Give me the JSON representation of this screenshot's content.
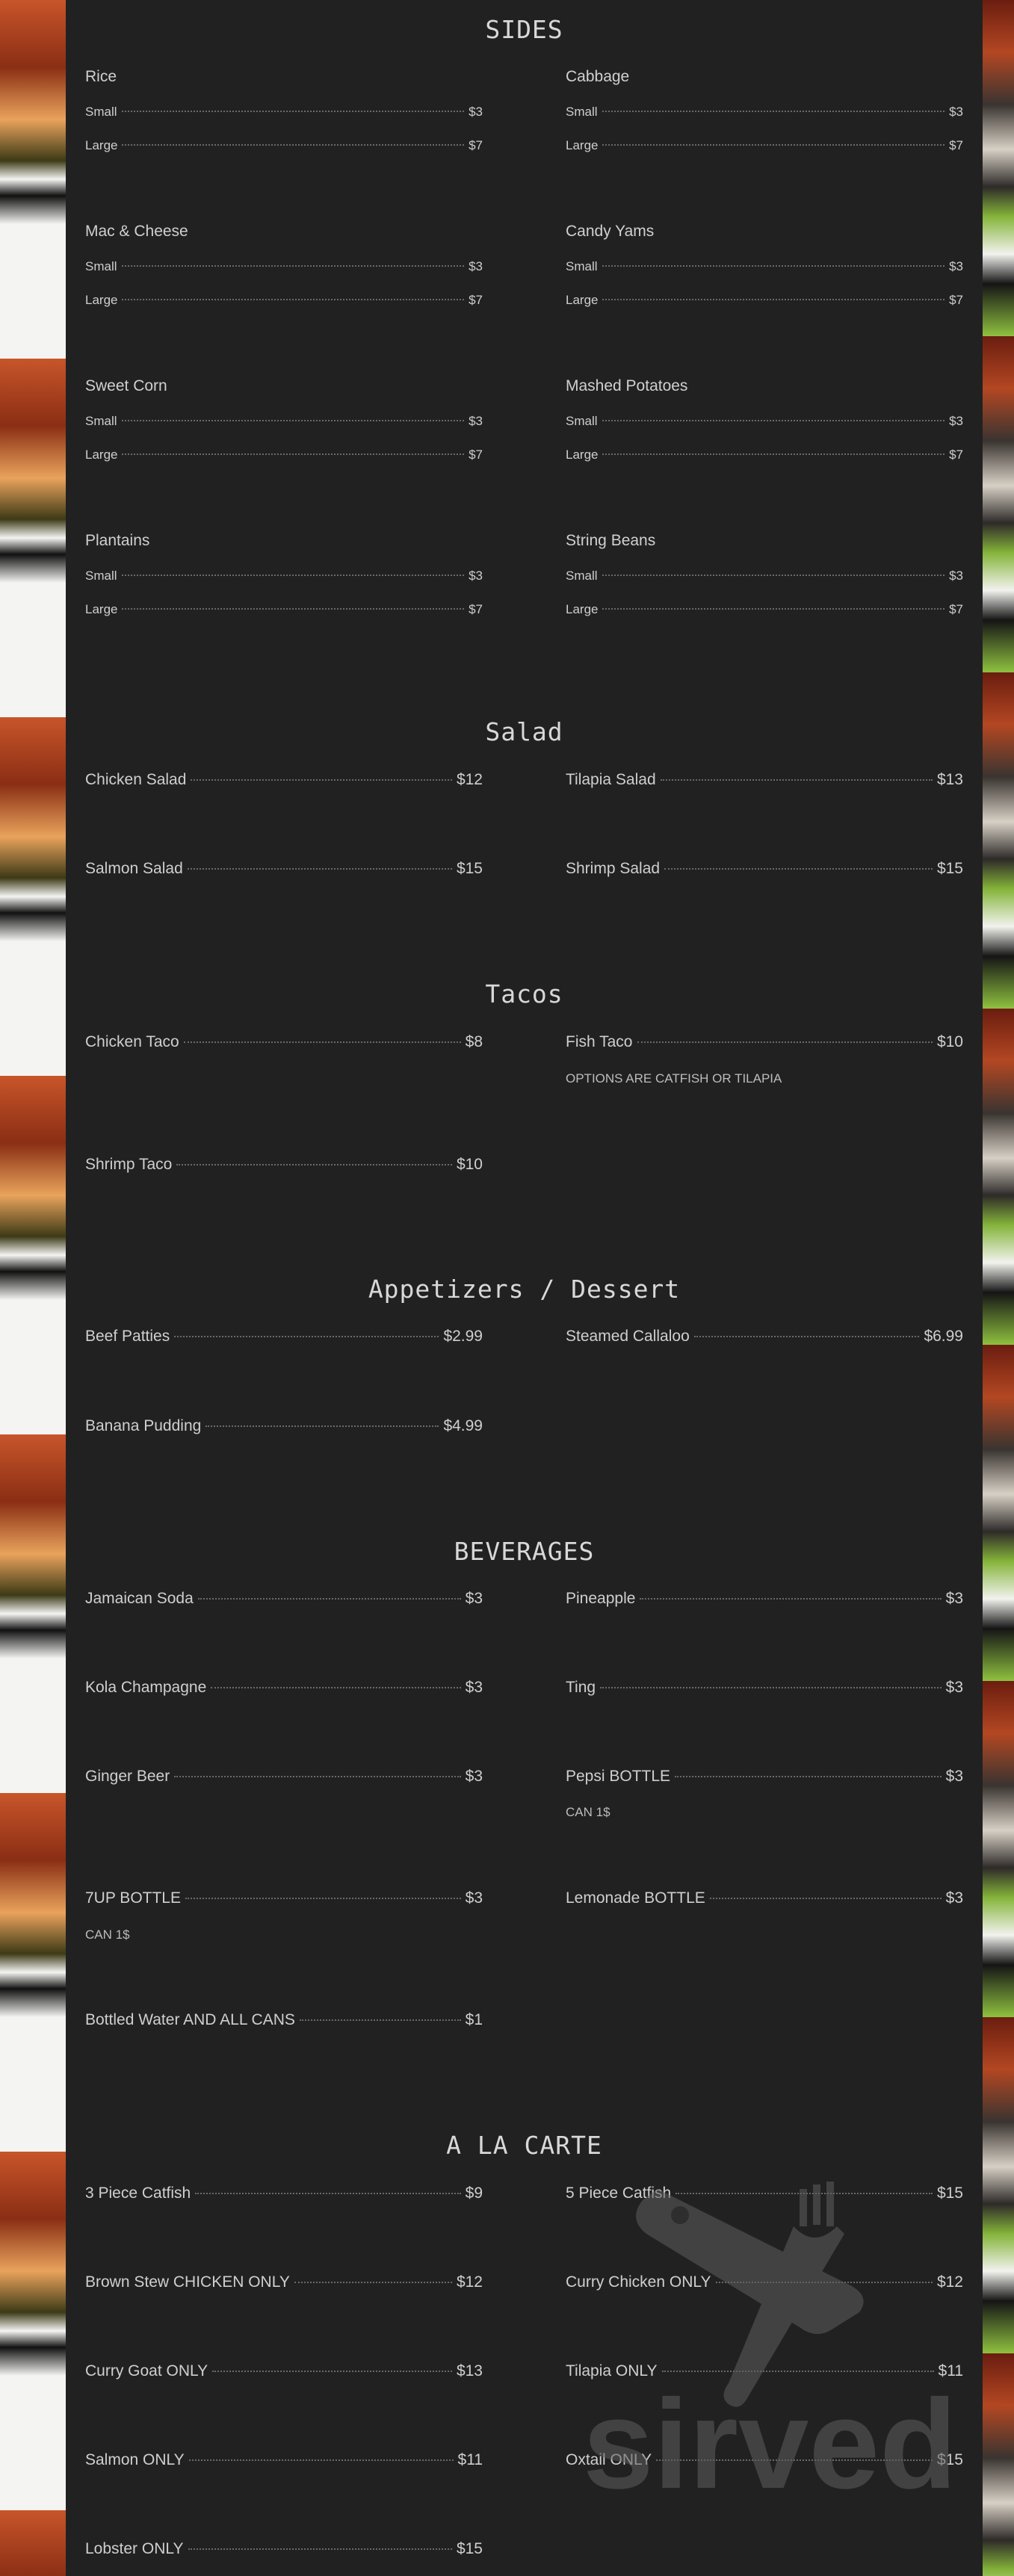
{
  "sides": {
    "title": "SIDES",
    "items": [
      {
        "name": "Rice",
        "small": "$3",
        "large": "$7"
      },
      {
        "name": "Cabbage",
        "small": "$3",
        "large": "$7"
      },
      {
        "name": "Mac & Cheese",
        "small": "$3",
        "large": "$7"
      },
      {
        "name": "Candy Yams",
        "small": "$3",
        "large": "$7"
      },
      {
        "name": "Sweet Corn",
        "small": "$3",
        "large": "$7"
      },
      {
        "name": "Mashed Potatoes",
        "small": "$3",
        "large": "$7"
      },
      {
        "name": "Plantains",
        "small": "$3",
        "large": "$7"
      },
      {
        "name": "String Beans",
        "small": "$3",
        "large": "$7"
      }
    ],
    "small_label": "Small",
    "large_label": "Large"
  },
  "salad": {
    "title": "Salad",
    "items": [
      {
        "name": "Chicken Salad",
        "price": "$12"
      },
      {
        "name": "Tilapia Salad",
        "price": "$13"
      },
      {
        "name": "Salmon Salad",
        "price": "$15"
      },
      {
        "name": "Shrimp Salad",
        "price": "$15"
      }
    ]
  },
  "tacos": {
    "title": "Tacos",
    "items": [
      {
        "name": "Chicken Taco",
        "price": "$8"
      },
      {
        "name": "Fish Taco",
        "price": "$10"
      },
      {
        "name": "Shrimp Taco",
        "price": "$10"
      }
    ],
    "fish_note": "OPTIONS ARE CATFISH OR TILAPIA"
  },
  "appetizers": {
    "title": "Appetizers / Dessert",
    "items": [
      {
        "name": "Beef Patties",
        "price": "$2.99"
      },
      {
        "name": "Steamed Callaloo",
        "price": "$6.99"
      },
      {
        "name": "Banana Pudding",
        "price": "$4.99"
      }
    ]
  },
  "beverages": {
    "title": "BEVERAGES",
    "items": [
      {
        "name": "Jamaican Soda",
        "price": "$3"
      },
      {
        "name": "Pineapple",
        "price": "$3"
      },
      {
        "name": "Kola Champagne",
        "price": "$3"
      },
      {
        "name": "Ting",
        "price": "$3"
      },
      {
        "name": "Ginger Beer",
        "price": "$3"
      },
      {
        "name": "Pepsi BOTTLE",
        "price": "$3"
      },
      {
        "name": "7UP BOTTLE",
        "price": "$3"
      },
      {
        "name": "Lemonade BOTTLE",
        "price": "$3"
      },
      {
        "name": "Bottled Water AND ALL CANS",
        "price": "$1"
      }
    ],
    "can_note": "CAN 1$"
  },
  "a_la_carte": {
    "title": "A LA CARTE",
    "items": [
      {
        "name": "3 Piece Catfish",
        "price": "$9"
      },
      {
        "name": "5 Piece Catfish",
        "price": "$15"
      },
      {
        "name": "Brown Stew CHICKEN ONLY",
        "price": "$12"
      },
      {
        "name": "Curry Chicken ONLY",
        "price": "$12"
      },
      {
        "name": "Curry Goat ONLY",
        "price": "$13"
      },
      {
        "name": "Tilapia ONLY",
        "price": "$11"
      },
      {
        "name": "Salmon ONLY",
        "price": "$11"
      },
      {
        "name": "Oxtail ONLY",
        "price": "$15"
      },
      {
        "name": "Lobster ONLY",
        "price": "$15"
      }
    ]
  },
  "watermark": {
    "brand": "sirved",
    "icon": "knife-fork-icon",
    "color": "#6a6a6a"
  }
}
